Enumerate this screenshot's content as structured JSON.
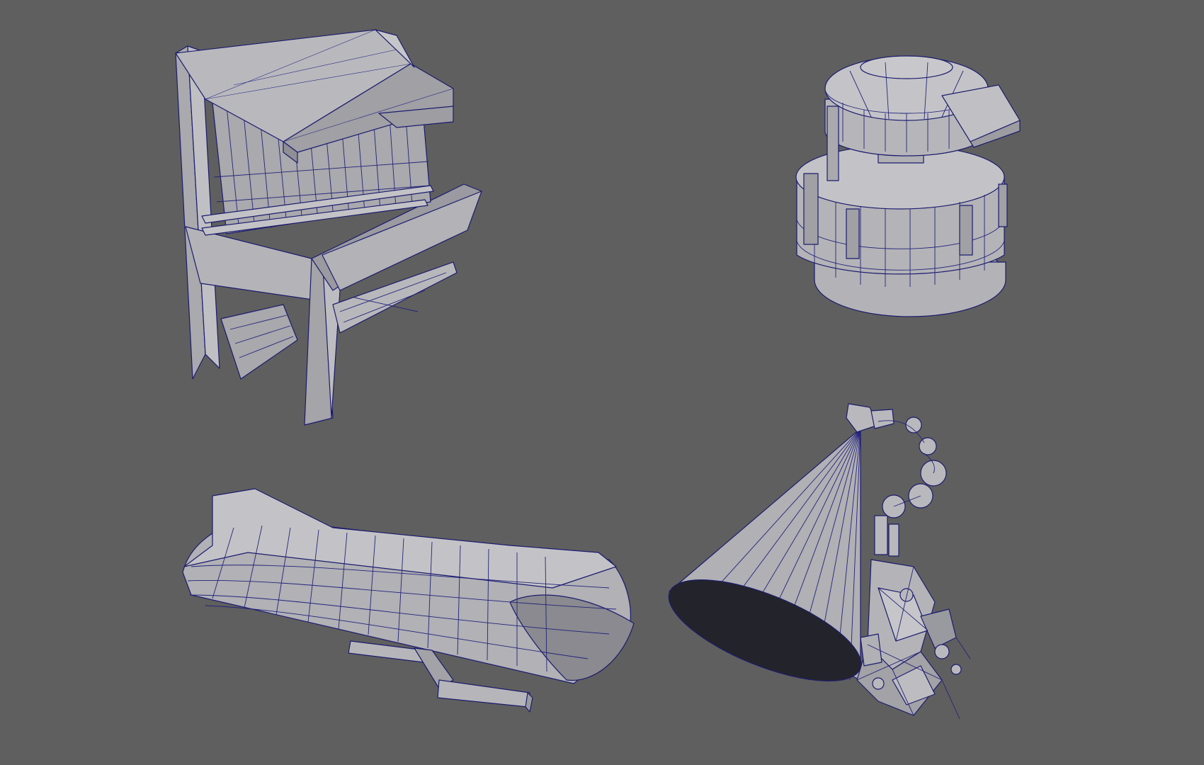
{
  "viewport": {
    "background": "#5f5f5f",
    "mesh_fill_light": "#b9b9bd",
    "mesh_fill_mid": "#9d9da2",
    "mesh_fill_dark": "#7c7c82",
    "wire_color": "#1c1c6e"
  },
  "objects": [
    {
      "name": "watch-tower-mesh"
    },
    {
      "name": "cylinder-pod-mesh"
    },
    {
      "name": "broken-pipe-mesh"
    },
    {
      "name": "cone-wreck-mesh"
    }
  ]
}
